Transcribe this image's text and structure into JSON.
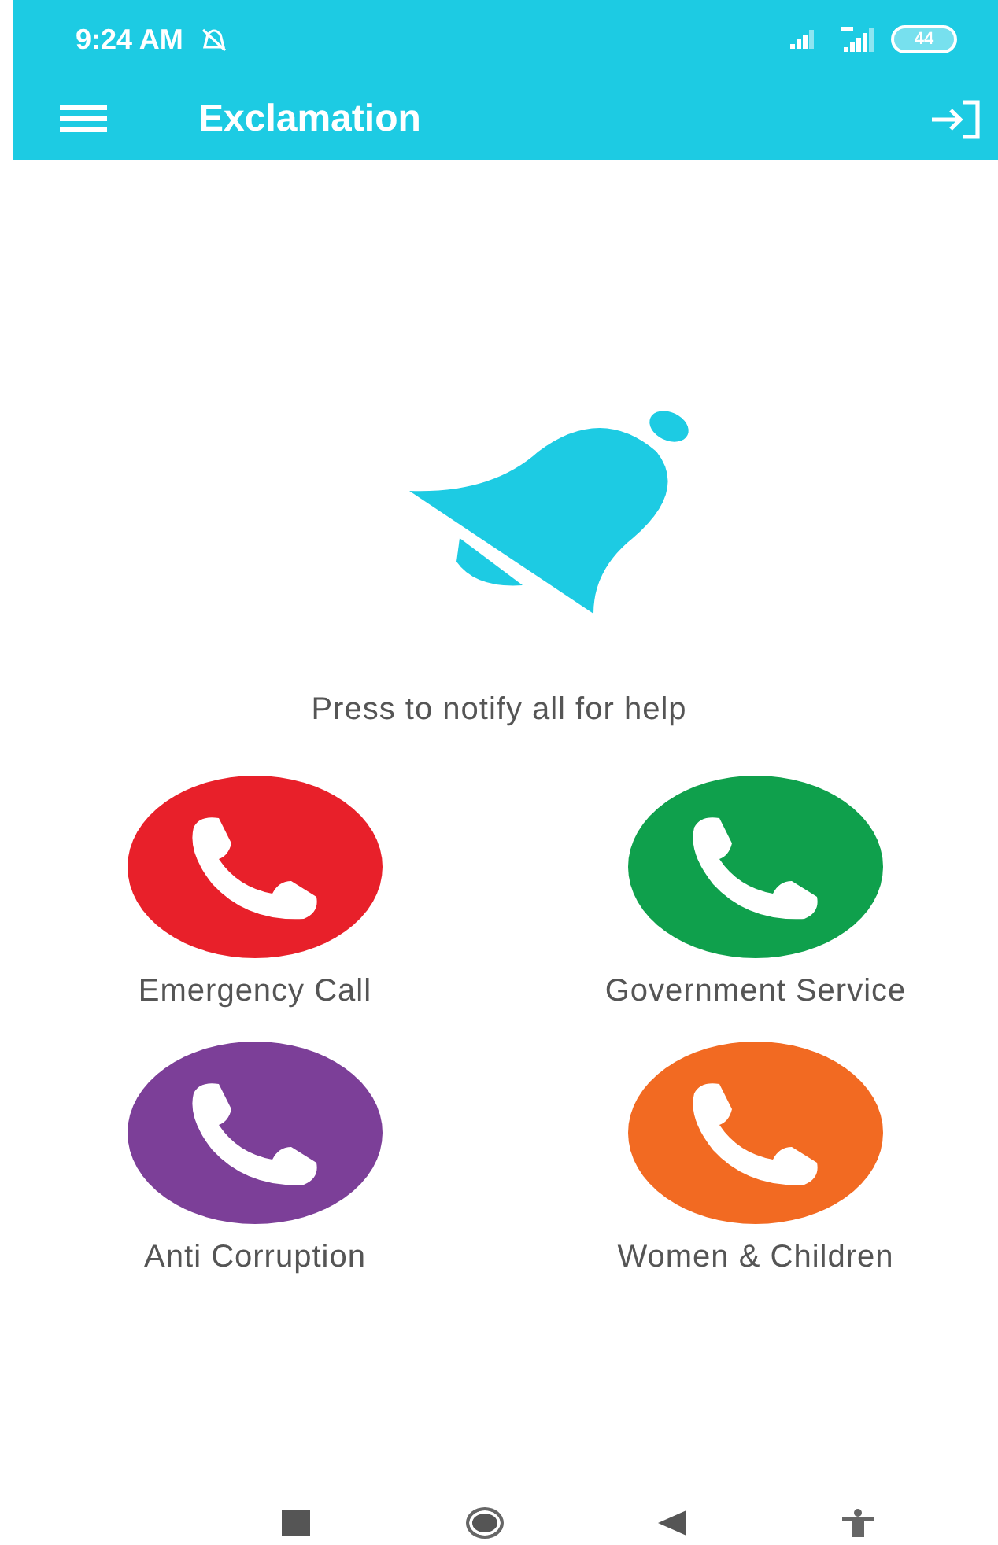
{
  "status_bar": {
    "time": "9:24 AM",
    "battery": "44"
  },
  "app_bar": {
    "title": "Exclamation"
  },
  "prompt": "Press to notify all for help",
  "call_buttons": [
    {
      "label": "Emergency Call",
      "color": "#e8202a"
    },
    {
      "label": "Government Service",
      "color": "#0fa04c"
    },
    {
      "label": "Anti Corruption",
      "color": "#7c3f98"
    },
    {
      "label": "Women & Children",
      "color": "#f26a22"
    }
  ]
}
